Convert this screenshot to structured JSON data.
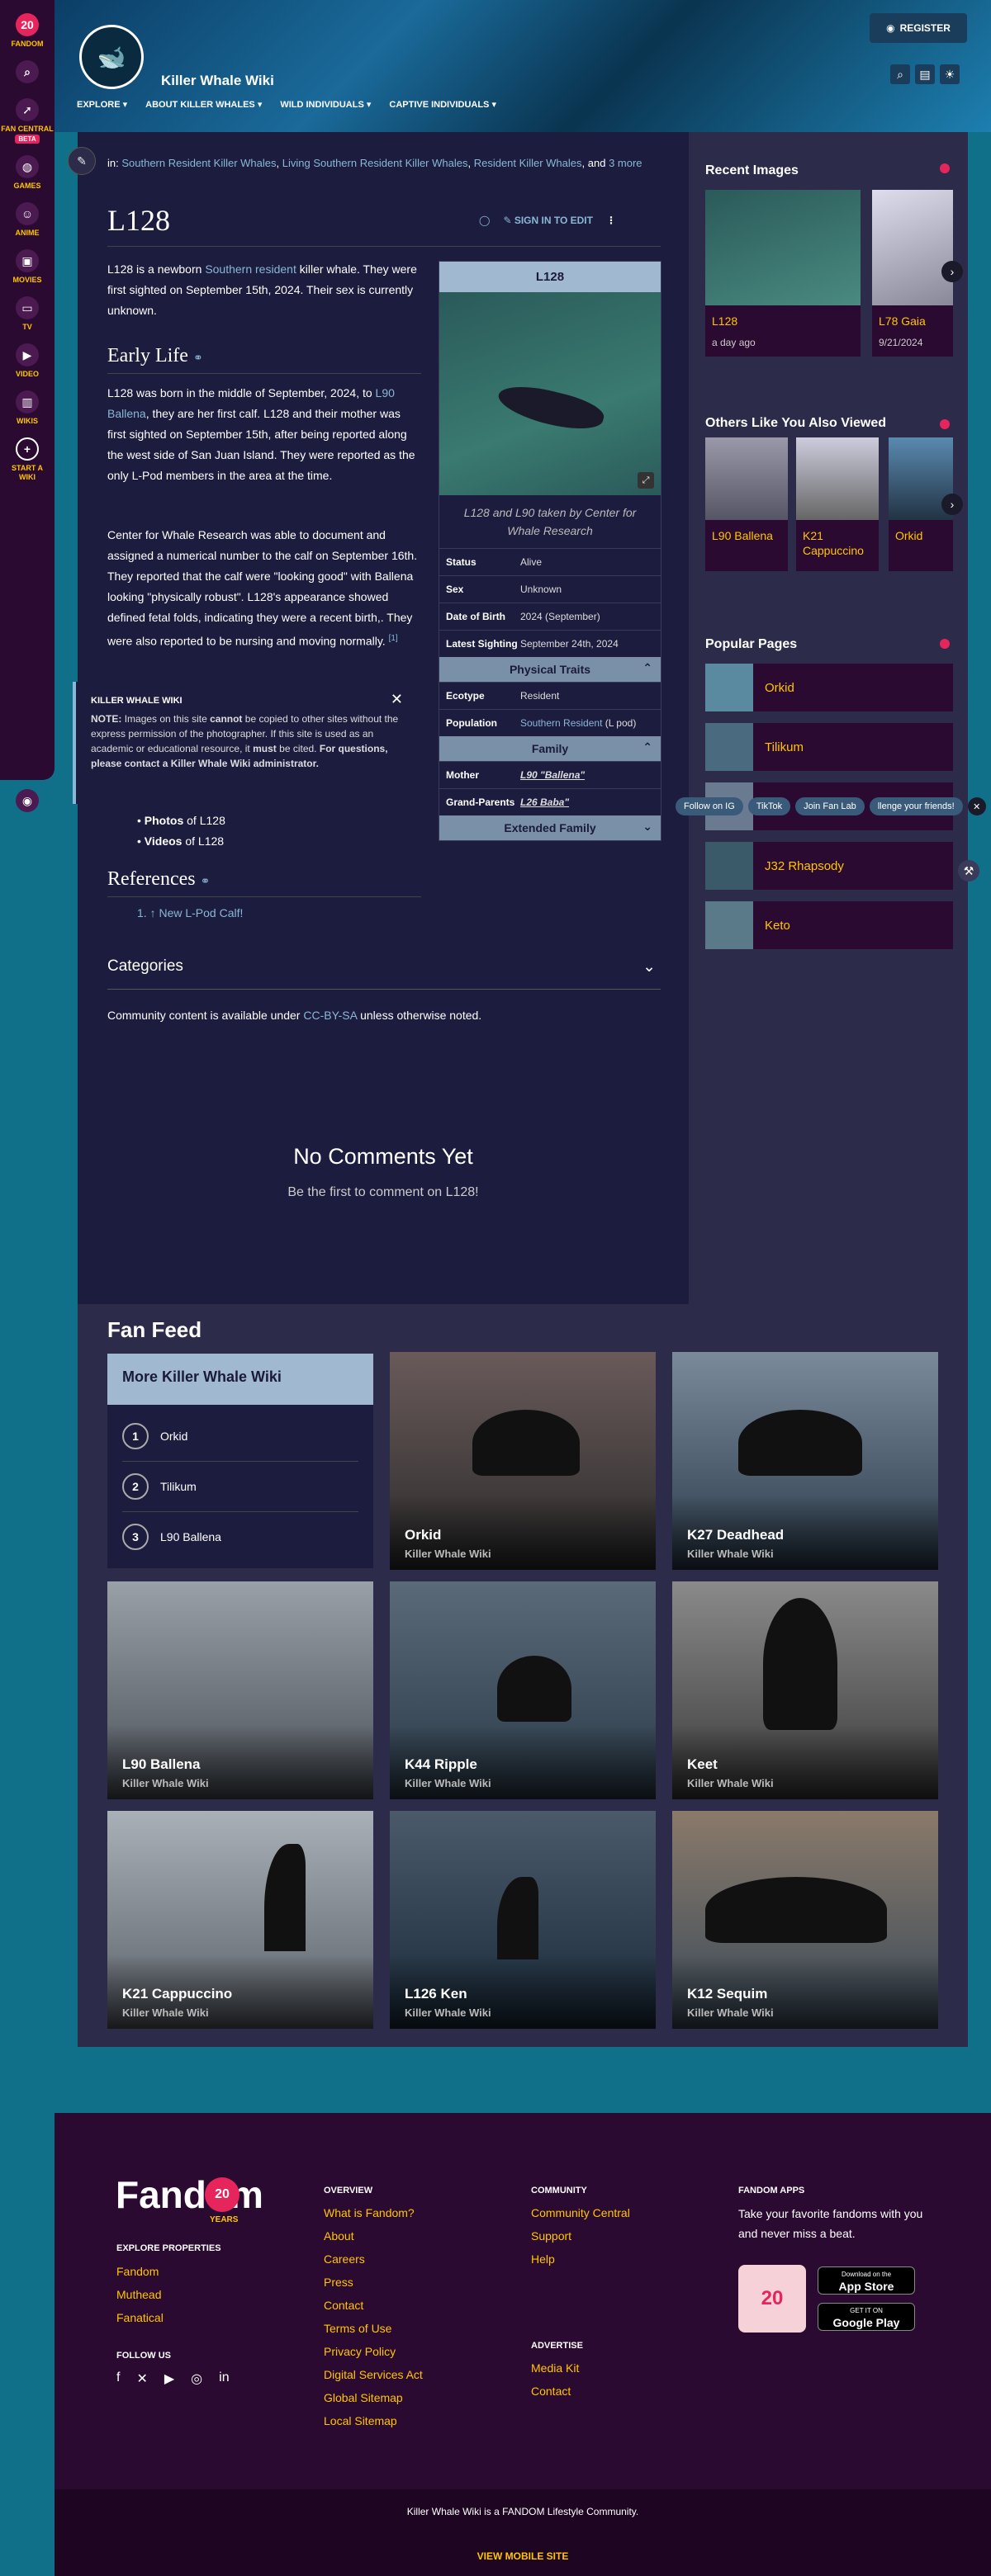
{
  "fandom": {
    "logo_label": "FANDOM",
    "nav": [
      {
        "label": "FANDOM",
        "icon": "fandom-logo-icon"
      },
      {
        "label": "FAN CENTRAL",
        "badge": "BETA"
      },
      {
        "label": "GAMES"
      },
      {
        "label": "ANIME"
      },
      {
        "label": "MOVIES"
      },
      {
        "label": "TV"
      },
      {
        "label": "VIDEO"
      },
      {
        "label": "WIKIS"
      },
      {
        "label": "START A WIKI"
      }
    ]
  },
  "header": {
    "wiki_name": "Killer Whale Wiki",
    "register_label": "REGISTER",
    "nav_items": [
      "EXPLORE",
      "ABOUT KILLER WHALES",
      "WILD INDIVIDUALS",
      "CAPTIVE INDIVIDUALS"
    ]
  },
  "article": {
    "categories_prefix": "in:",
    "categories": [
      "Southern Resident Killer Whales",
      "Living Southern Resident Killer Whales",
      "Resident Killer Whales"
    ],
    "categories_more_prefix": "and",
    "categories_more": "3 more",
    "title": "L128",
    "signin_label": "SIGN IN TO EDIT",
    "intro_1": "L128 is a newborn",
    "intro_link": "Southern resident",
    "intro_2": "killer whale. They were first sighted on September 15th, 2024. Their sex is currently unknown.",
    "section_early": "Early Life",
    "early_p1_a": "L128 was born in the middle of September, 2024, to",
    "early_p1_link": "L90 Ballena",
    "early_p1_b": ", they are her first calf. L128 and their mother was first sighted on September 15th, after being reported along the west side of San Juan Island. They were reported as the only L-Pod members in the area at the time.",
    "early_p2": "Center for Whale Research was able to document and assigned a numerical number to the calf on September 16th. They reported that the calf were \"looking good\" with Ballena looking \"physically robust\". L128's appearance showed defined fetal folds, indicating they were a recent birth,. They were also reported to be nursing and moving normally.",
    "early_p2_ref": "[1]",
    "gallery_items": [
      {
        "bold": "Photos",
        "rest": "of L128"
      },
      {
        "bold": "Videos",
        "rest": "of L128"
      }
    ],
    "section_refs": "References",
    "ref_1": "1. ↑ New L-Pod Calf!",
    "categories_label": "Categories",
    "license_a": "Community content is available under",
    "license_link": "CC-BY-SA",
    "license_b": "unless otherwise noted."
  },
  "notice": {
    "title": "KILLER WHALE WIKI",
    "text_a": "NOTE:",
    "text_b": "Images on this site",
    "text_c": "cannot",
    "text_d": "be copied to other sites without the express permission of the photographer. If this site is used as an academic or educational resource, it",
    "text_e": "must",
    "text_f": "be cited.",
    "text_g": "For questions, please contact a Killer Whale Wiki administrator."
  },
  "infobox": {
    "title": "L128",
    "caption": "L128 and L90 taken by Center for Whale Research",
    "rows": [
      {
        "k": "Status",
        "v": "Alive"
      },
      {
        "k": "Sex",
        "v": "Unknown"
      },
      {
        "k": "Date of Birth",
        "v": "2024 (September)"
      },
      {
        "k": "Latest Sighting",
        "v": "September 24th, 2024"
      }
    ],
    "physical_head": "Physical Traits",
    "ecotype_k": "Ecotype",
    "ecotype_v": "Resident",
    "population_k": "Population",
    "population_v": "Southern Resident",
    "population_v2": "(L pod)",
    "family_head": "Family",
    "mother_k": "Mother",
    "mother_v": "L90 \"Ballena\"",
    "grand_k": "Grand-Parents",
    "grand_v": "L26 Baba\"",
    "extended_head": "Extended Family"
  },
  "comments": {
    "title": "No Comments Yet",
    "subtitle": "Be the first to comment on L128!"
  },
  "rail": {
    "recent_title": "Recent Images",
    "recent": [
      {
        "label": "L128",
        "date": "a day ago"
      },
      {
        "label": "L78 Gaia",
        "date": "9/21/2024"
      }
    ],
    "others_title": "Others Like You Also Viewed",
    "others": [
      "L90 Ballena",
      "K21 Cappuccino",
      "Orkid"
    ],
    "popular_title": "Popular Pages",
    "popular": [
      "Orkid",
      "Tilikum",
      "",
      "J32 Rhapsody",
      "Keto"
    ],
    "chips": [
      "Follow on IG",
      "TikTok",
      "Join Fan Lab",
      "llenge your friends!"
    ]
  },
  "feed": {
    "title": "Fan Feed",
    "more_title": "More Killer Whale Wiki",
    "more_items": [
      {
        "n": "1",
        "label": "Orkid"
      },
      {
        "n": "2",
        "label": "Tilikum"
      },
      {
        "n": "3",
        "label": "L90 Ballena"
      }
    ],
    "tiles": [
      {
        "title": "Orkid",
        "sub": "Killer Whale Wiki"
      },
      {
        "title": "K27 Deadhead",
        "sub": "Killer Whale Wiki"
      },
      {
        "title": "L90 Ballena",
        "sub": "Killer Whale Wiki"
      },
      {
        "title": "K44 Ripple",
        "sub": "Killer Whale Wiki"
      },
      {
        "title": "Keet",
        "sub": "Killer Whale Wiki"
      },
      {
        "title": "K21 Cappuccino",
        "sub": "Killer Whale Wiki"
      },
      {
        "title": "L126 Ken",
        "sub": "Killer Whale Wiki"
      },
      {
        "title": "K12 Sequim",
        "sub": "Killer Whale Wiki"
      }
    ]
  },
  "footer": {
    "logo": "Fandom",
    "years_badge": "20",
    "years_label": "YEARS",
    "explore_title": "EXPLORE PROPERTIES",
    "explore": [
      "Fandom",
      "Muthead",
      "Fanatical"
    ],
    "follow_title": "FOLLOW US",
    "overview_title": "OVERVIEW",
    "overview": [
      "What is Fandom?",
      "About",
      "Careers",
      "Press",
      "Contact",
      "Terms of Use",
      "Privacy Policy",
      "Digital Services Act",
      "Global Sitemap",
      "Local Sitemap"
    ],
    "community_title": "COMMUNITY",
    "community": [
      "Community Central",
      "Support",
      "Help"
    ],
    "advertise_title": "ADVERTISE",
    "advertise": [
      "Media Kit",
      "Contact"
    ],
    "apps_title": "FANDOM APPS",
    "apps_text": "Take your favorite fandoms with you and never miss a beat.",
    "app_store": "App Store",
    "app_store_small": "Download on the",
    "google_play": "Google Play",
    "google_play_small": "GET IT ON",
    "community_note": "Killer Whale Wiki is a FANDOM Lifestyle Community.",
    "mobile_link": "VIEW MOBILE SITE"
  }
}
